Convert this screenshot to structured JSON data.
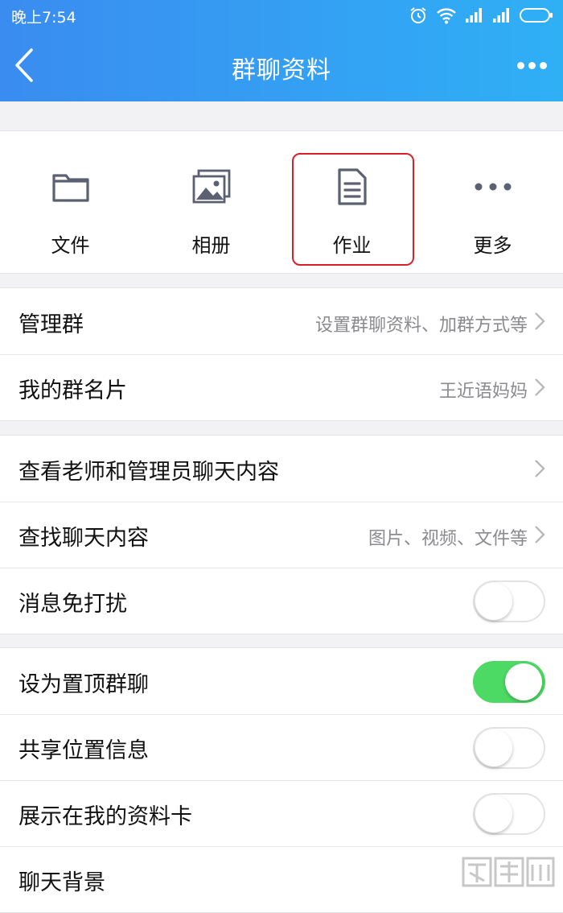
{
  "status_bar": {
    "time": "晚上7:54",
    "icons": [
      "alarm-icon",
      "wifi-icon",
      "signal-icon",
      "signal-icon",
      "battery-icon"
    ]
  },
  "app_bar": {
    "title": "群聊资料",
    "back_icon": "chevron-left-icon",
    "more_icon": "more-dots-icon"
  },
  "shortcuts": [
    {
      "label": "文件",
      "icon": "folder-icon"
    },
    {
      "label": "相册",
      "icon": "album-icon"
    },
    {
      "label": "作业",
      "icon": "homework-document-icon",
      "highlighted": true
    },
    {
      "label": "更多",
      "icon": "more-dots-icon"
    }
  ],
  "group_manage": [
    {
      "title": "管理群",
      "value": "设置群聊资料、加群方式等"
    },
    {
      "title": "我的群名片",
      "value": "王近语妈妈"
    }
  ],
  "group_chat": [
    {
      "title": "查看老师和管理员聊天内容",
      "value": ""
    },
    {
      "title": "查找聊天内容",
      "value": "图片、视频、文件等"
    },
    {
      "title": "消息免打扰",
      "toggle": false
    }
  ],
  "group_settings": [
    {
      "title": "设为置顶群聊",
      "toggle": true
    },
    {
      "title": "共享位置信息",
      "toggle": false
    },
    {
      "title": "展示在我的资料卡",
      "toggle": false
    },
    {
      "title": "聊天背景",
      "value": ""
    }
  ],
  "colors": {
    "header_start": "#3a8cf0",
    "header_end": "#2fb0f5",
    "toggle_on": "#4cd964",
    "highlight": "#d9202a",
    "icon_gray": "#5b6072"
  }
}
